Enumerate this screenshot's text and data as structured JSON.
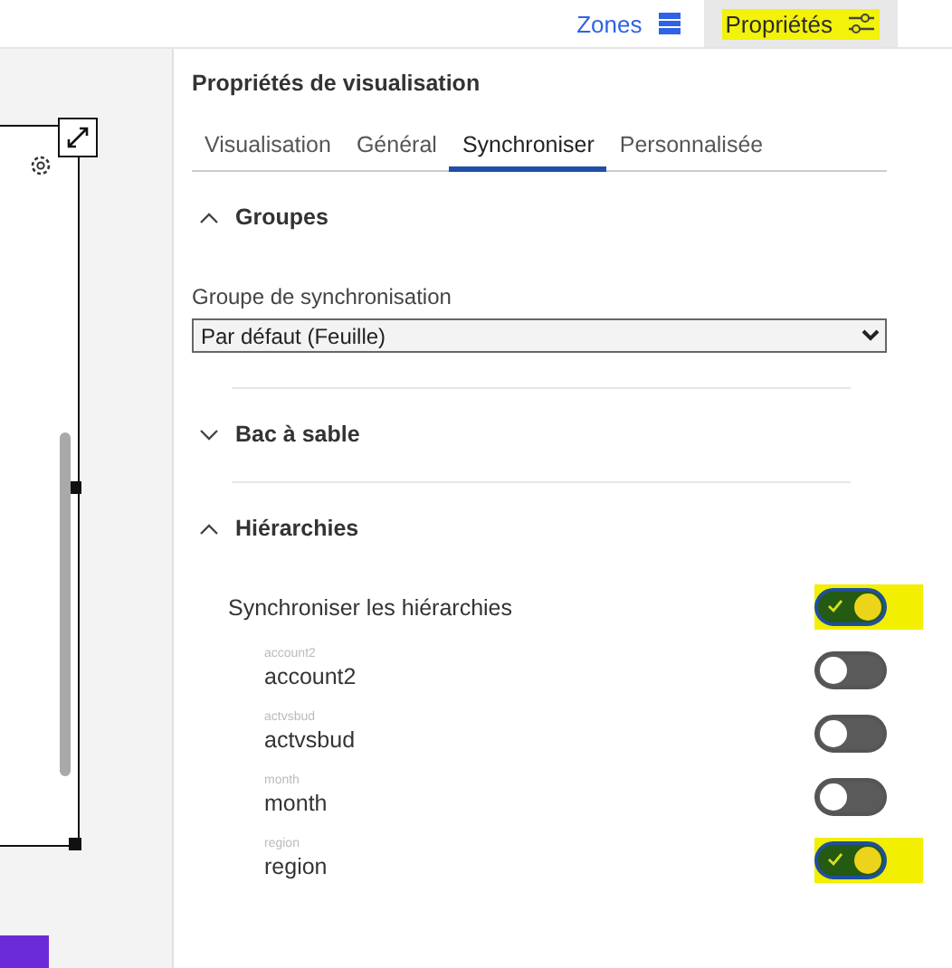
{
  "header": {
    "links": [
      {
        "label": "Zones",
        "selected": false,
        "highlighted": false
      },
      {
        "label": "Propriétés",
        "selected": true,
        "highlighted": true
      }
    ]
  },
  "panel": {
    "title": "Propriétés de visualisation",
    "tabs": [
      {
        "label": "Visualisation",
        "selected": false
      },
      {
        "label": "Général",
        "selected": false
      },
      {
        "label": "Synchroniser",
        "selected": true
      },
      {
        "label": "Personnalisée",
        "selected": false
      }
    ],
    "sections": [
      {
        "title": "Groupes",
        "expanded": true,
        "field": {
          "label": "Groupe de synchronisation",
          "value": "Par défaut (Feuille)"
        }
      },
      {
        "title": "Bac à sable",
        "expanded": false
      },
      {
        "title": "Hiérarchies",
        "expanded": true,
        "master": {
          "label": "Synchroniser les hiérarchies",
          "on": true,
          "highlighted": true
        },
        "items": [
          {
            "caption": "account2",
            "label": "account2",
            "on": false,
            "highlighted": false
          },
          {
            "caption": "actvsbud",
            "label": "actvsbud",
            "on": false,
            "highlighted": false
          },
          {
            "caption": "month",
            "label": "month",
            "on": false,
            "highlighted": false
          },
          {
            "caption": "region",
            "label": "region",
            "on": true,
            "highlighted": true
          }
        ]
      }
    ]
  }
}
